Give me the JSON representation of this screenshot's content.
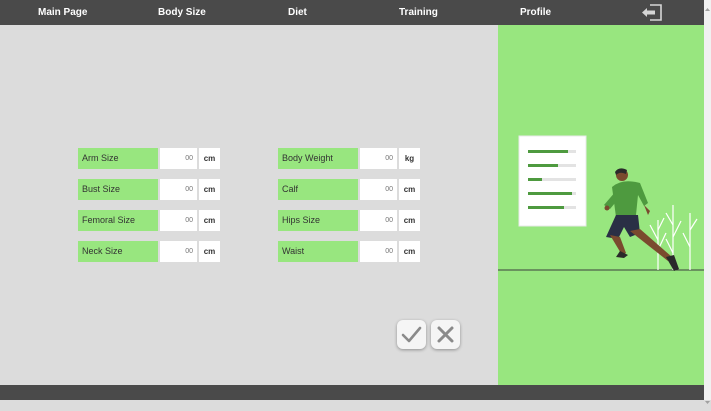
{
  "nav": {
    "items": [
      "Main Page",
      "Body Size",
      "Diet",
      "Training",
      "Profile"
    ],
    "logout_icon": "logout-icon"
  },
  "form": {
    "left": [
      {
        "label": "Arm Size",
        "value": "",
        "placeholder": "00",
        "unit": "cm"
      },
      {
        "label": "Bust Size",
        "value": "",
        "placeholder": "00",
        "unit": "cm"
      },
      {
        "label": "Femoral Size",
        "value": "",
        "placeholder": "00",
        "unit": "cm"
      },
      {
        "label": "Neck Size",
        "value": "",
        "placeholder": "00",
        "unit": "cm"
      }
    ],
    "right": [
      {
        "label": "Body Weight",
        "value": "",
        "placeholder": "00",
        "unit": "kg"
      },
      {
        "label": "Calf",
        "value": "",
        "placeholder": "00",
        "unit": "cm"
      },
      {
        "label": "Hips Size",
        "value": "",
        "placeholder": "00",
        "unit": "cm"
      },
      {
        "label": "Waist",
        "value": "",
        "placeholder": "00",
        "unit": "cm"
      }
    ]
  },
  "actions": {
    "confirm_icon": "check-icon",
    "cancel_icon": "close-icon"
  },
  "colors": {
    "accent": "#98e67f",
    "header": "#4a4a4a",
    "background": "#dcdcdc"
  }
}
